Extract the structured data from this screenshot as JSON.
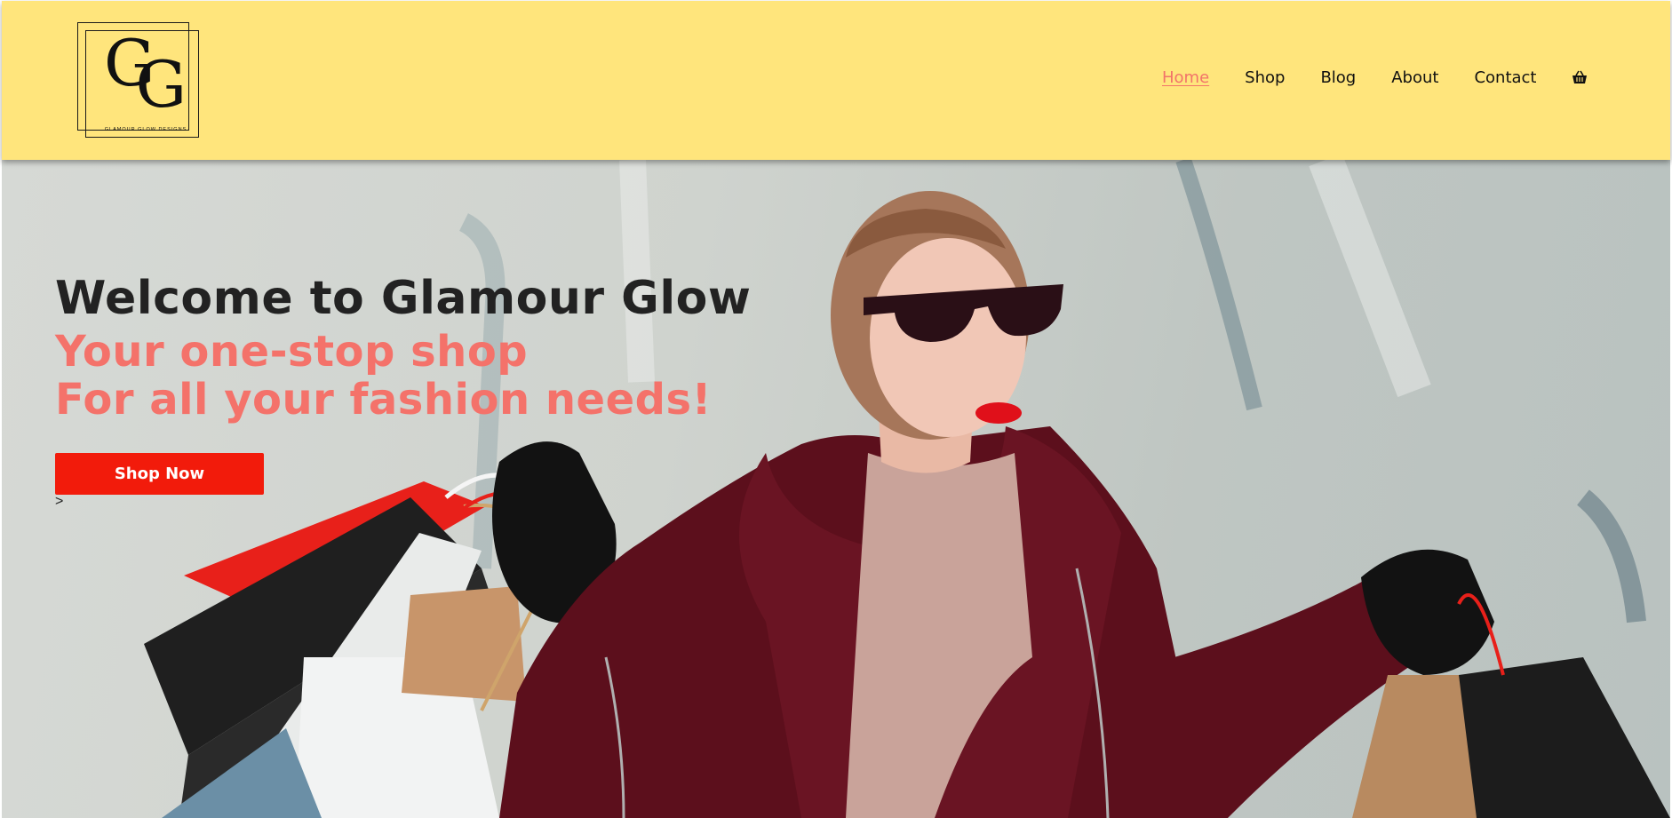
{
  "brand": {
    "monogram_1": "G",
    "monogram_2": "G",
    "tagline": "GLAMOUR GLOW DESIGNS"
  },
  "nav": {
    "items": [
      {
        "label": "Home",
        "active": true
      },
      {
        "label": "Shop",
        "active": false
      },
      {
        "label": "Blog",
        "active": false
      },
      {
        "label": "About",
        "active": false
      },
      {
        "label": "Contact",
        "active": false
      }
    ],
    "cart_icon": "basket-icon"
  },
  "hero": {
    "headline": "Welcome to Glamour Glow",
    "subline_1": "Your one-stop shop",
    "subline_2": "For all your fashion needs!",
    "cta_label": "Shop Now",
    "cta_suffix": ">"
  },
  "colors": {
    "header_bg": "#ffe57c",
    "accent": "#f4726a",
    "cta": "#f21b0b",
    "text_dark": "#222222"
  }
}
